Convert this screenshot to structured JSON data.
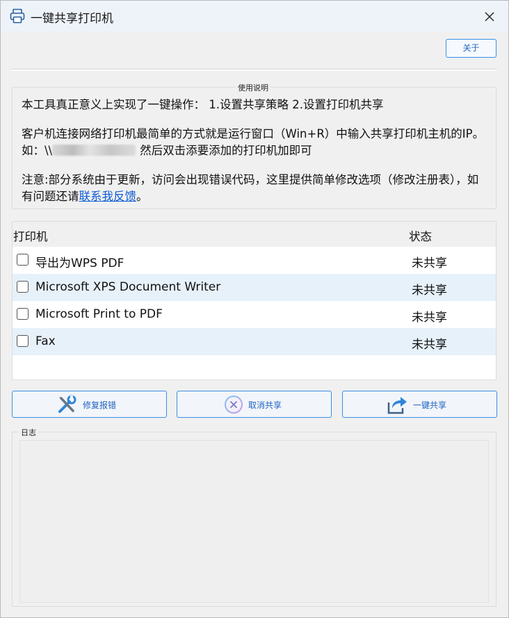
{
  "window": {
    "title": "一键共享打印机"
  },
  "toolbar": {
    "about_label": "关于"
  },
  "instructions": {
    "group_label": "使用说明",
    "line1": "本工具真正意义上实现了一键操作： 1.设置共享策略 2.设置打印机共享",
    "line2_part1": "客户机连接网络打印机最简单的方式就是运行窗口（Win+R）中输入共享打印机主机的IP。如：\\\\",
    "line2_part2": "然后双击添要添加的打印机加即可",
    "line3_part1": "注意:部分系统由于更新，访问会出现错误代码，这里提供简单修改选项（修改注册表），如有问题还请",
    "line3_link": "联系我反馈",
    "line3_part2": "。"
  },
  "printer_list": {
    "col_printer": "打印机",
    "col_status": "状态",
    "rows": [
      {
        "name": "导出为WPS PDF",
        "status": "未共享",
        "checked": false
      },
      {
        "name": "Microsoft XPS Document Writer",
        "status": "未共享",
        "checked": false
      },
      {
        "name": "Microsoft Print to PDF",
        "status": "未共享",
        "checked": false
      },
      {
        "name": "Fax",
        "status": "未共享",
        "checked": false
      }
    ]
  },
  "actions": {
    "repair_label": "修复报错",
    "cancel_label": "取消共享",
    "share_label": "一键共享"
  },
  "log": {
    "group_label": "日志",
    "content": ""
  },
  "icons": {
    "title": "printer-icon",
    "close": "close-icon",
    "repair": "tools-icon",
    "cancel": "cancel-circle-icon",
    "share": "share-arrow-icon"
  },
  "colors": {
    "accent": "#3a8ee6",
    "link": "#0a5bd6",
    "row_alt": "#e6f1fa"
  }
}
